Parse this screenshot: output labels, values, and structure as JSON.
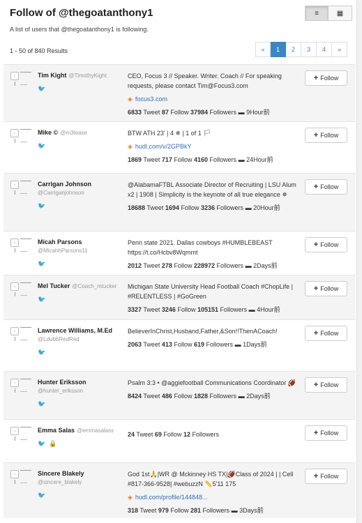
{
  "header": {
    "title": "Follow of @thegoatanthony1",
    "subtitle": "A list of users that @thegoatanthony1 is following.",
    "view_list_icon": "≡",
    "view_grid_icon": "▦"
  },
  "results": {
    "count": "1 - 50 of 840 Results",
    "pager": [
      "«",
      "1",
      "2",
      "3",
      "4",
      "»"
    ]
  },
  "follow_label": "Follow",
  "users": [
    {
      "name": "Tim Kight",
      "handle": "@TimothyKight",
      "bio": "CEO, Focus 3 // Speaker. Writer. Coach // For speaking requests, please contact Tim@Focus3.com",
      "link": "focus3.com",
      "tweet": "6833",
      "follow": "87",
      "followers": "37984",
      "time": "9Hour前"
    },
    {
      "name": "Mike ©",
      "handle": "@m3tease",
      "bio": "BTW ATH 23' | 4 ✵ | 1 of 1 🏳",
      "link": "hudl.com/v/2GPBkY",
      "tweet": "1869",
      "follow": "717",
      "followers": "4160",
      "time": "24Hour前"
    },
    {
      "name": "Carrigan Johnson",
      "handle": "@Carriganjohnson",
      "bio": "@AlabamaFTBL Associate Director of Recruiting | LSU Alum x2 | 1908 | Simplicity is the keynote of all true elegance ✵",
      "link": "",
      "tweet": "18688",
      "follow": "1694",
      "followers": "3236",
      "time": "20Hour前"
    },
    {
      "name": "Micah Parsons",
      "handle": "@MicahhParsons11",
      "bio": "Penn state 2021. Dallas cowboys #HUMBLEBEAST https://t.co/Hcbv8Wqmmt",
      "link": "",
      "tweet": "2012",
      "follow": "278",
      "followers": "228972",
      "time": "2Days前"
    },
    {
      "name": "Mel Tucker",
      "handle": "@Coach_mtucker",
      "bio": "Michigan State University Head Football Coach #ChopLife | #RELENTLESS | #GoGreen",
      "link": "",
      "tweet": "3327",
      "follow": "3246",
      "followers": "105151",
      "time": "4Hour前"
    },
    {
      "name": "Lawrence Williams, M.Ed",
      "handle": "@LdubbRedRed",
      "bio": "BelieverInChrist,Husband,Father,&Son!!ThenACoach!",
      "link": "",
      "tweet": "2063",
      "follow": "413",
      "followers": "619",
      "time": "1Days前"
    },
    {
      "name": "Hunter Eriksson",
      "handle": "@hunter_eriksson",
      "bio": "Psalm 3:3 • @aggiefootball Communications Coordinator 🏈",
      "link": "",
      "tweet": "8424",
      "follow": "486",
      "followers": "1828",
      "time": "2Days前"
    },
    {
      "name": "Emma Salas",
      "handle": "@emmasalass",
      "bio": "",
      "link": "",
      "tweet": "24",
      "follow": "69",
      "followers": "12",
      "time": ""
    },
    {
      "name": "Sincere Blakely",
      "handle": "@sincere_blakely",
      "bio": "God 1st🙏|WR @ Mckinney HS TX|🏈Class of 2024 | | Cell #817-366-9528| #webuzzN 📏5'11 175",
      "link": "hudl.com/profile/144848...",
      "tweet": "318",
      "follow": "979",
      "followers": "281",
      "time": "3Days前"
    }
  ],
  "labels": {
    "tweet": "Tweet",
    "follow": "Follow",
    "followers": "Followers"
  }
}
